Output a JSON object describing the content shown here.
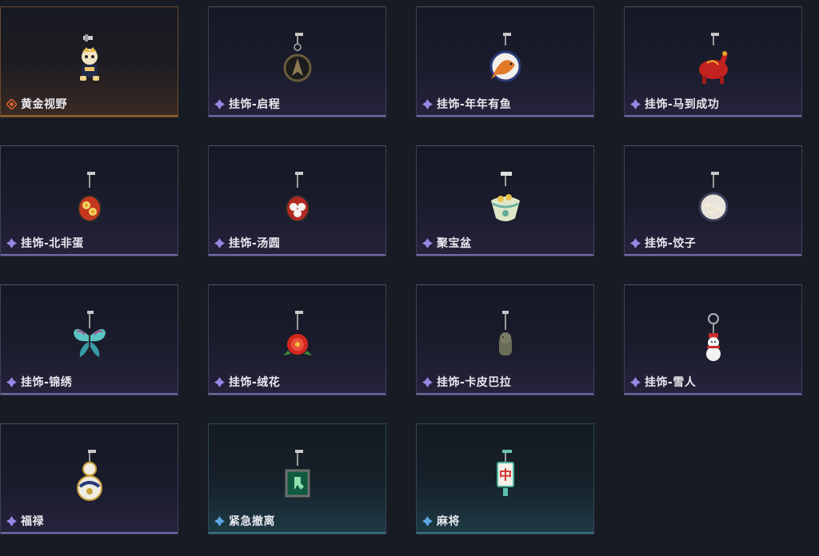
{
  "colors": {
    "gold_rarity": "#d7622e",
    "purple_rarity": "#9a86e6",
    "blue_rarity": "#5aa6e0"
  },
  "items": [
    {
      "name": "黄金视野",
      "rarity": "gold",
      "icon": "golden-vision-charm-icon"
    },
    {
      "name": "挂饰-启程",
      "rarity": "purple",
      "icon": "departure-charm-icon"
    },
    {
      "name": "挂饰-年年有鱼",
      "rarity": "purple",
      "icon": "fish-charm-icon"
    },
    {
      "name": "挂饰-马到成功",
      "rarity": "purple",
      "icon": "horse-charm-icon"
    },
    {
      "name": "挂饰-北非蛋",
      "rarity": "purple",
      "icon": "shakshuka-charm-icon"
    },
    {
      "name": "挂饰-汤圆",
      "rarity": "purple",
      "icon": "tangyuan-charm-icon"
    },
    {
      "name": "聚宝盆",
      "rarity": "purple",
      "icon": "treasure-bowl-charm-icon"
    },
    {
      "name": "挂饰-饺子",
      "rarity": "purple",
      "icon": "dumpling-charm-icon"
    },
    {
      "name": "挂饰-锦绣",
      "rarity": "purple",
      "icon": "butterfly-charm-icon"
    },
    {
      "name": "挂饰-绒花",
      "rarity": "purple",
      "icon": "velvet-flower-charm-icon"
    },
    {
      "name": "挂饰-卡皮巴拉",
      "rarity": "purple",
      "icon": "capybara-charm-icon"
    },
    {
      "name": "挂饰-雪人",
      "rarity": "purple",
      "icon": "snowman-charm-icon"
    },
    {
      "name": "福禄",
      "rarity": "purple",
      "icon": "gourd-charm-icon"
    },
    {
      "name": "紧急撤离",
      "rarity": "blue",
      "icon": "emergency-exit-charm-icon"
    },
    {
      "name": "麻将",
      "rarity": "blue",
      "icon": "mahjong-charm-icon"
    }
  ],
  "mahjong_tile_char": "中"
}
